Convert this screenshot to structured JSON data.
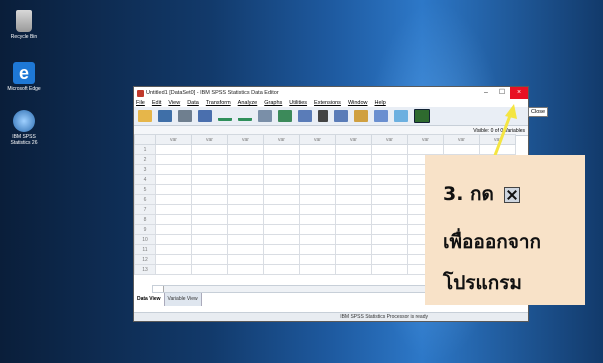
{
  "desktop": {
    "icons": [
      {
        "label": "Recycle Bin"
      },
      {
        "label": "Microsoft Edge"
      },
      {
        "label": "IBM SPSS Statistics 26"
      }
    ]
  },
  "window": {
    "title": "Untitled1 [DataSet0] - IBM SPSS Statistics Data Editor",
    "minimize": "–",
    "maximize": "☐",
    "close": "×",
    "close_tooltip": "Close"
  },
  "menu": [
    "File",
    "Edit",
    "View",
    "Data",
    "Transform",
    "Analyze",
    "Graphs",
    "Utilities",
    "Extensions",
    "Window",
    "Help"
  ],
  "cellbar": {
    "visible_text": "Visible: 0 of 0 Variables"
  },
  "grid": {
    "columns": [
      "var",
      "var",
      "var",
      "var",
      "var",
      "var",
      "var",
      "var",
      "var",
      "var"
    ],
    "rows": [
      "1",
      "2",
      "3",
      "4",
      "5",
      "6",
      "7",
      "8",
      "9",
      "10",
      "11",
      "12",
      "13"
    ]
  },
  "tabs": {
    "data_view": "Data View",
    "variable_view": "Variable View"
  },
  "status": {
    "text": "IBM SPSS Statistics Processor is ready"
  },
  "annotation": {
    "line1": "3. กด",
    "line2": "เพื่อออกจาก",
    "line3": "โปรแกรม",
    "arrow_color": "#f4e542"
  },
  "colors": {
    "close_button": "#e81123",
    "note_bg": "#f8e2c8"
  }
}
